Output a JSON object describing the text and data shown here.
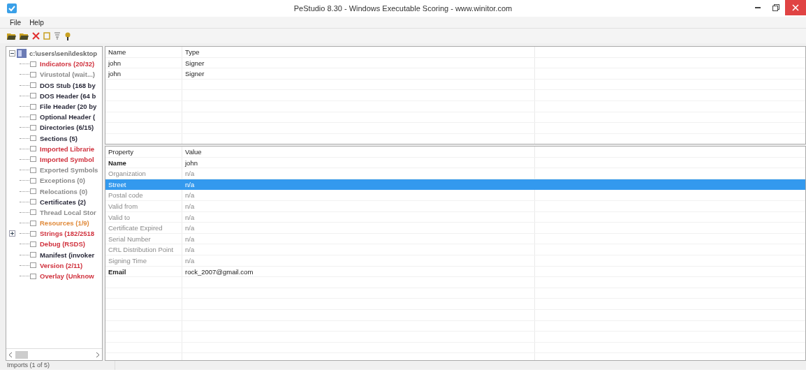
{
  "window": {
    "title": "PeStudio 8.30 - Windows Executable Scoring - www.winitor.com"
  },
  "menu": [
    "File",
    "Help"
  ],
  "tree": {
    "label": "c:\\users\\seni\\desktop",
    "expanded": true,
    "children": [
      {
        "label": "Indicators (20/32)",
        "color": "#d0313d",
        "kind": "leaf"
      },
      {
        "label": "Virustotal (wait...)",
        "color": "#8a8a8a",
        "kind": "leaf"
      },
      {
        "label": "DOS Stub (168 by",
        "color": "#2a2a3a",
        "kind": "leaf"
      },
      {
        "label": "DOS Header (64 b",
        "color": "#2a2a3a",
        "kind": "leaf"
      },
      {
        "label": "File Header (20 by",
        "color": "#2a2a3a",
        "kind": "leaf"
      },
      {
        "label": "Optional Header (",
        "color": "#2a2a3a",
        "kind": "leaf"
      },
      {
        "label": "Directories (6/15)",
        "color": "#2a2a3a",
        "kind": "leaf"
      },
      {
        "label": "Sections (5)",
        "color": "#2a2a3a",
        "kind": "leaf"
      },
      {
        "label": "Imported Librarie",
        "color": "#d0313d",
        "kind": "leaf"
      },
      {
        "label": "Imported Symbol",
        "color": "#d0313d",
        "kind": "leaf"
      },
      {
        "label": "Exported Symbols",
        "color": "#8a8a8a",
        "kind": "leaf"
      },
      {
        "label": "Exceptions (0)",
        "color": "#8a8a8a",
        "kind": "leaf"
      },
      {
        "label": "Relocations (0)",
        "color": "#8a8a8a",
        "kind": "leaf"
      },
      {
        "label": "Certificates (2)",
        "color": "#2a2a3a",
        "kind": "leaf"
      },
      {
        "label": "Thread Local Stor",
        "color": "#8a8a8a",
        "kind": "leaf"
      },
      {
        "label": "Resources (1/9)",
        "color": "#e08a3a",
        "kind": "leaf"
      },
      {
        "label": "Strings (182/2518",
        "color": "#d0313d",
        "kind": "collapsed"
      },
      {
        "label": "Debug (RSDS)",
        "color": "#d0313d",
        "kind": "leaf"
      },
      {
        "label": "Manifest (invoker",
        "color": "#2a2a3a",
        "kind": "leaf"
      },
      {
        "label": "Version (2/11)",
        "color": "#d0313d",
        "kind": "leaf"
      },
      {
        "label": "Overlay (Unknow",
        "color": "#d0313d",
        "kind": "leaf"
      }
    ]
  },
  "signers": {
    "columns": [
      "Name",
      "Type"
    ],
    "rows": [
      {
        "cells": [
          "john",
          "Signer"
        ]
      },
      {
        "cells": [
          "john",
          "Signer"
        ]
      }
    ]
  },
  "properties": {
    "columns": [
      "Property",
      "Value"
    ],
    "rows": [
      {
        "cells": [
          "Name",
          "john"
        ],
        "greyed": false,
        "selected": false
      },
      {
        "cells": [
          "Organization",
          "n/a"
        ],
        "greyed": true,
        "selected": false
      },
      {
        "cells": [
          "Street",
          "n/a"
        ],
        "greyed": true,
        "selected": true
      },
      {
        "cells": [
          "Postal code",
          "n/a"
        ],
        "greyed": true,
        "selected": false
      },
      {
        "cells": [
          "Valid from",
          "n/a"
        ],
        "greyed": true,
        "selected": false
      },
      {
        "cells": [
          "Valid to",
          "n/a"
        ],
        "greyed": true,
        "selected": false
      },
      {
        "cells": [
          "Certificate Expired",
          "n/a"
        ],
        "greyed": true,
        "selected": false
      },
      {
        "cells": [
          "Serial Number",
          "n/a"
        ],
        "greyed": true,
        "selected": false
      },
      {
        "cells": [
          "CRL Distribution Point",
          "n/a"
        ],
        "greyed": true,
        "selected": false
      },
      {
        "cells": [
          "Signing Time",
          "n/a"
        ],
        "greyed": true,
        "selected": false
      },
      {
        "cells": [
          "Email",
          "rock_2007@gmail.com"
        ],
        "greyed": false,
        "selected": false
      }
    ]
  },
  "status_bar": {
    "text": "Imports (1 of 5)"
  }
}
